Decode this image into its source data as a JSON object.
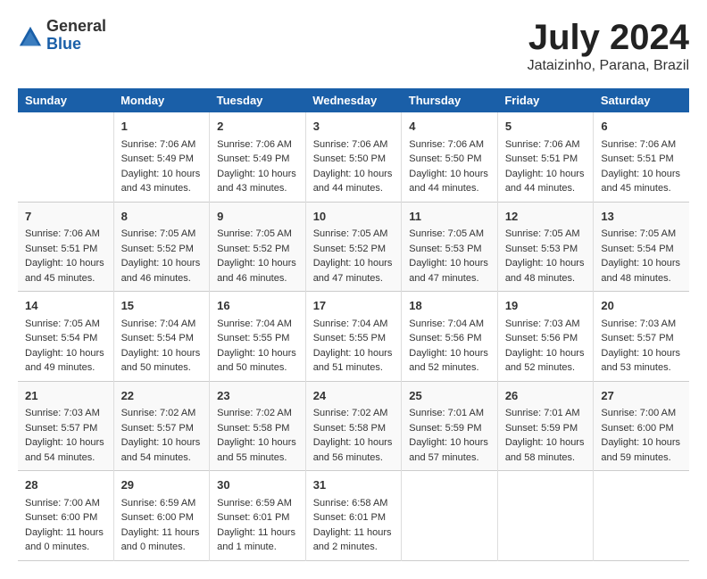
{
  "header": {
    "logo_general": "General",
    "logo_blue": "Blue",
    "month_year": "July 2024",
    "location": "Jataizinho, Parana, Brazil"
  },
  "calendar": {
    "days_of_week": [
      "Sunday",
      "Monday",
      "Tuesday",
      "Wednesday",
      "Thursday",
      "Friday",
      "Saturday"
    ],
    "weeks": [
      [
        {
          "day": "",
          "content": ""
        },
        {
          "day": "1",
          "content": "Sunrise: 7:06 AM\nSunset: 5:49 PM\nDaylight: 10 hours\nand 43 minutes."
        },
        {
          "day": "2",
          "content": "Sunrise: 7:06 AM\nSunset: 5:49 PM\nDaylight: 10 hours\nand 43 minutes."
        },
        {
          "day": "3",
          "content": "Sunrise: 7:06 AM\nSunset: 5:50 PM\nDaylight: 10 hours\nand 44 minutes."
        },
        {
          "day": "4",
          "content": "Sunrise: 7:06 AM\nSunset: 5:50 PM\nDaylight: 10 hours\nand 44 minutes."
        },
        {
          "day": "5",
          "content": "Sunrise: 7:06 AM\nSunset: 5:51 PM\nDaylight: 10 hours\nand 44 minutes."
        },
        {
          "day": "6",
          "content": "Sunrise: 7:06 AM\nSunset: 5:51 PM\nDaylight: 10 hours\nand 45 minutes."
        }
      ],
      [
        {
          "day": "7",
          "content": "Sunrise: 7:06 AM\nSunset: 5:51 PM\nDaylight: 10 hours\nand 45 minutes."
        },
        {
          "day": "8",
          "content": "Sunrise: 7:05 AM\nSunset: 5:52 PM\nDaylight: 10 hours\nand 46 minutes."
        },
        {
          "day": "9",
          "content": "Sunrise: 7:05 AM\nSunset: 5:52 PM\nDaylight: 10 hours\nand 46 minutes."
        },
        {
          "day": "10",
          "content": "Sunrise: 7:05 AM\nSunset: 5:52 PM\nDaylight: 10 hours\nand 47 minutes."
        },
        {
          "day": "11",
          "content": "Sunrise: 7:05 AM\nSunset: 5:53 PM\nDaylight: 10 hours\nand 47 minutes."
        },
        {
          "day": "12",
          "content": "Sunrise: 7:05 AM\nSunset: 5:53 PM\nDaylight: 10 hours\nand 48 minutes."
        },
        {
          "day": "13",
          "content": "Sunrise: 7:05 AM\nSunset: 5:54 PM\nDaylight: 10 hours\nand 48 minutes."
        }
      ],
      [
        {
          "day": "14",
          "content": "Sunrise: 7:05 AM\nSunset: 5:54 PM\nDaylight: 10 hours\nand 49 minutes."
        },
        {
          "day": "15",
          "content": "Sunrise: 7:04 AM\nSunset: 5:54 PM\nDaylight: 10 hours\nand 50 minutes."
        },
        {
          "day": "16",
          "content": "Sunrise: 7:04 AM\nSunset: 5:55 PM\nDaylight: 10 hours\nand 50 minutes."
        },
        {
          "day": "17",
          "content": "Sunrise: 7:04 AM\nSunset: 5:55 PM\nDaylight: 10 hours\nand 51 minutes."
        },
        {
          "day": "18",
          "content": "Sunrise: 7:04 AM\nSunset: 5:56 PM\nDaylight: 10 hours\nand 52 minutes."
        },
        {
          "day": "19",
          "content": "Sunrise: 7:03 AM\nSunset: 5:56 PM\nDaylight: 10 hours\nand 52 minutes."
        },
        {
          "day": "20",
          "content": "Sunrise: 7:03 AM\nSunset: 5:57 PM\nDaylight: 10 hours\nand 53 minutes."
        }
      ],
      [
        {
          "day": "21",
          "content": "Sunrise: 7:03 AM\nSunset: 5:57 PM\nDaylight: 10 hours\nand 54 minutes."
        },
        {
          "day": "22",
          "content": "Sunrise: 7:02 AM\nSunset: 5:57 PM\nDaylight: 10 hours\nand 54 minutes."
        },
        {
          "day": "23",
          "content": "Sunrise: 7:02 AM\nSunset: 5:58 PM\nDaylight: 10 hours\nand 55 minutes."
        },
        {
          "day": "24",
          "content": "Sunrise: 7:02 AM\nSunset: 5:58 PM\nDaylight: 10 hours\nand 56 minutes."
        },
        {
          "day": "25",
          "content": "Sunrise: 7:01 AM\nSunset: 5:59 PM\nDaylight: 10 hours\nand 57 minutes."
        },
        {
          "day": "26",
          "content": "Sunrise: 7:01 AM\nSunset: 5:59 PM\nDaylight: 10 hours\nand 58 minutes."
        },
        {
          "day": "27",
          "content": "Sunrise: 7:00 AM\nSunset: 6:00 PM\nDaylight: 10 hours\nand 59 minutes."
        }
      ],
      [
        {
          "day": "28",
          "content": "Sunrise: 7:00 AM\nSunset: 6:00 PM\nDaylight: 11 hours\nand 0 minutes."
        },
        {
          "day": "29",
          "content": "Sunrise: 6:59 AM\nSunset: 6:00 PM\nDaylight: 11 hours\nand 0 minutes."
        },
        {
          "day": "30",
          "content": "Sunrise: 6:59 AM\nSunset: 6:01 PM\nDaylight: 11 hours\nand 1 minute."
        },
        {
          "day": "31",
          "content": "Sunrise: 6:58 AM\nSunset: 6:01 PM\nDaylight: 11 hours\nand 2 minutes."
        },
        {
          "day": "",
          "content": ""
        },
        {
          "day": "",
          "content": ""
        },
        {
          "day": "",
          "content": ""
        }
      ]
    ]
  }
}
